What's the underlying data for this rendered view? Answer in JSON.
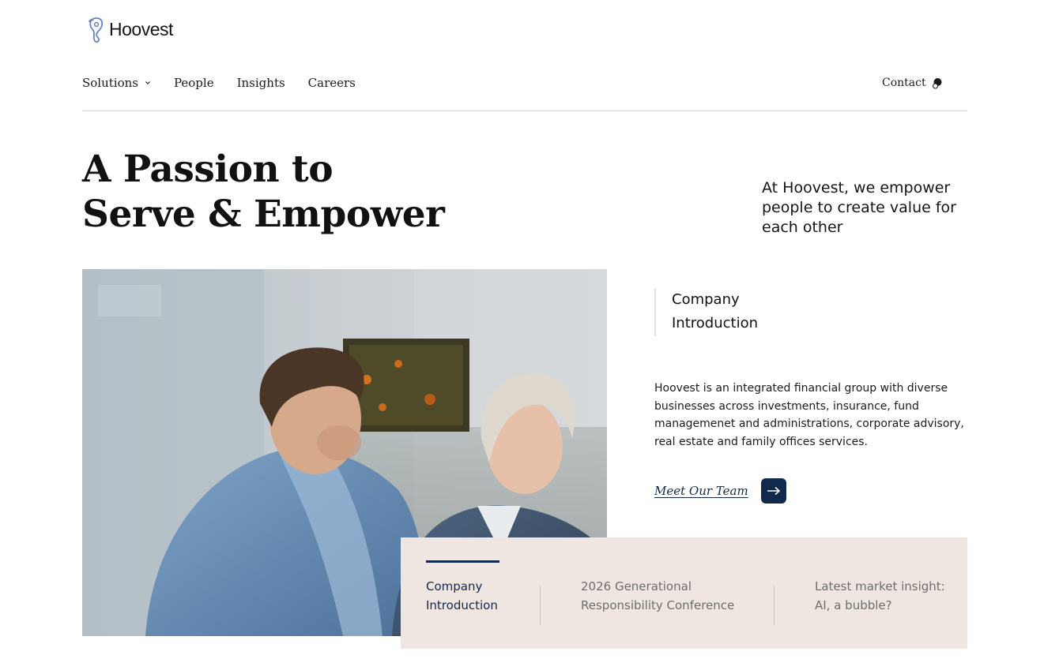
{
  "brand": {
    "name": "Hoovest"
  },
  "nav": {
    "items": [
      {
        "label": "Solutions",
        "has_dropdown": true
      },
      {
        "label": "People"
      },
      {
        "label": "Insights"
      },
      {
        "label": "Careers"
      }
    ],
    "contact_label": "Contact",
    "contact_icon": "chat-bubble-icon"
  },
  "hero": {
    "headline_line1": "A Passion to",
    "headline_line2": "Serve & Empower",
    "tagline": "At Hoovest, we empower people to create value for each other"
  },
  "intro": {
    "title_line1": "Company",
    "title_line2": "Introduction",
    "body": "Hoovest is an integrated financial group with diverse businesses across investments, insurance, fund managemenet and administrations, corporate advisory, real estate and family offices services.",
    "link_label": "Meet Our Team",
    "link_icon": "arrow-right-icon"
  },
  "tabs": [
    {
      "line1": "Company",
      "line2": "Introduction",
      "active": true
    },
    {
      "line1": "2026 Generational",
      "line2": "Responsibility Conference",
      "active": false
    },
    {
      "line1": "Latest market insight:",
      "line2": "AI, a bubble?",
      "active": false
    }
  ],
  "colors": {
    "accent": "#13294b",
    "panel_bg": "#f0e6e1",
    "rule": "#cfcfcf",
    "logo_mark": "#6a82c4"
  }
}
